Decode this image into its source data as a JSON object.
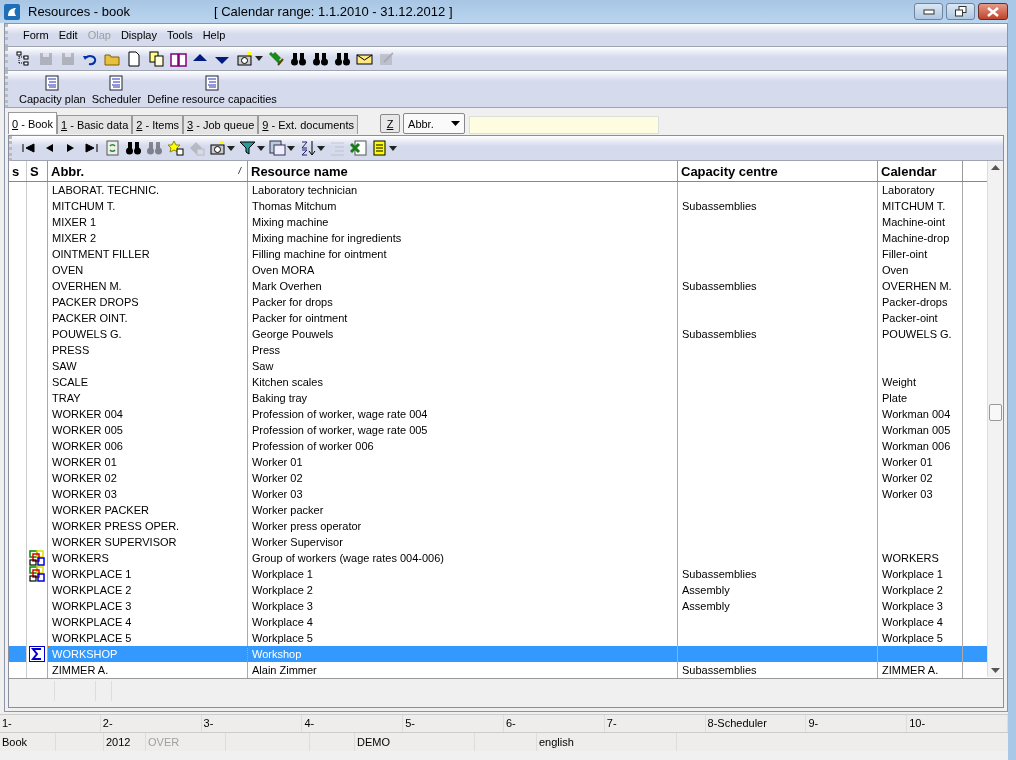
{
  "window": {
    "title": "Resources - book",
    "subtitle": "[ Calendar range: 1.1.2010 - 31.12.2012 ]"
  },
  "menu": [
    {
      "label": "Form",
      "disabled": false
    },
    {
      "label": "Edit",
      "disabled": false
    },
    {
      "label": "Olap",
      "disabled": true
    },
    {
      "label": "Display",
      "disabled": false
    },
    {
      "label": "Tools",
      "disabled": false
    },
    {
      "label": "Help",
      "disabled": false
    }
  ],
  "toolbar": [
    {
      "kind": "tree",
      "disabled": false
    },
    {
      "kind": "save",
      "disabled": true
    },
    {
      "kind": "saveas",
      "disabled": true
    },
    {
      "kind": "undo",
      "disabled": false
    },
    {
      "kind": "folder",
      "disabled": false
    },
    {
      "kind": "page",
      "disabled": false
    },
    {
      "kind": "copy",
      "disabled": false
    },
    {
      "kind": "book",
      "disabled": false
    },
    {
      "kind": "up",
      "disabled": false
    },
    {
      "kind": "down",
      "disabled": false
    },
    {
      "kind": "camera",
      "disabled": false
    },
    {
      "kind": "caret",
      "disabled": false
    },
    {
      "kind": "export",
      "disabled": false
    },
    {
      "kind": "binoculars",
      "disabled": false
    },
    {
      "kind": "binoculars",
      "disabled": false
    },
    {
      "kind": "binoculars",
      "disabled": false
    },
    {
      "kind": "mail",
      "disabled": false
    },
    {
      "kind": "edit",
      "disabled": true
    }
  ],
  "actions": [
    "Capacity plan",
    "Scheduler",
    "Define resource capacities"
  ],
  "tabs": [
    {
      "key": "0",
      "label": " - Book",
      "selected": true
    },
    {
      "key": "1",
      "label": " - Basic data",
      "selected": false
    },
    {
      "key": "2",
      "label": " - Items",
      "selected": false
    },
    {
      "key": "3",
      "label": " - Job queue",
      "selected": false
    },
    {
      "key": "9",
      "label": " - Ext. documents",
      "selected": false
    }
  ],
  "search": {
    "key_button": "Z",
    "field": "Abbr."
  },
  "nav_toolbar": [
    {
      "kind": "first",
      "disabled": false
    },
    {
      "kind": "prev",
      "disabled": false
    },
    {
      "kind": "next",
      "disabled": false
    },
    {
      "kind": "last",
      "disabled": false
    },
    {
      "kind": "refresh",
      "disabled": false
    },
    {
      "kind": "binoculars",
      "disabled": false
    },
    {
      "kind": "binoculars",
      "disabled": true
    },
    {
      "kind": "newstar",
      "disabled": false
    },
    {
      "kind": "remove",
      "disabled": true
    },
    {
      "kind": "camera",
      "disabled": false
    },
    {
      "kind": "caret",
      "disabled": false
    },
    {
      "kind": "filter",
      "disabled": false
    },
    {
      "kind": "caret",
      "disabled": false
    },
    {
      "kind": "columns",
      "disabled": false
    },
    {
      "kind": "caret",
      "disabled": false
    },
    {
      "kind": "sort",
      "disabled": false
    },
    {
      "kind": "caret",
      "disabled": false
    },
    {
      "kind": "indent",
      "disabled": true
    },
    {
      "kind": "excel",
      "disabled": false
    },
    {
      "kind": "note",
      "disabled": false
    },
    {
      "kind": "caret",
      "disabled": false
    }
  ],
  "table": {
    "columns": [
      {
        "label": "s"
      },
      {
        "label": "S"
      },
      {
        "label": "Abbr.",
        "sort": "/"
      },
      {
        "label": "Resource name"
      },
      {
        "label": "Capacity centre"
      },
      {
        "label": "Calendar"
      }
    ],
    "rows": [
      {
        "kind": "plain",
        "abbr": "LABORAT. TECHNIC.",
        "name": "Laboratory technician",
        "centre": "",
        "calendar": "Laboratory",
        "selected": false
      },
      {
        "kind": "plain",
        "abbr": "MITCHUM T.",
        "name": "Thomas Mitchum",
        "centre": "Subassemblies",
        "calendar": "MITCHUM T.",
        "selected": false
      },
      {
        "kind": "plain",
        "abbr": "MIXER 1",
        "name": "Mixing machine",
        "centre": "",
        "calendar": "Machine-oint",
        "selected": false
      },
      {
        "kind": "plain",
        "abbr": "MIXER 2",
        "name": "Mixing machine for ingredients",
        "centre": "",
        "calendar": "Machine-drop",
        "selected": false
      },
      {
        "kind": "plain",
        "abbr": "OINTMENT FILLER",
        "name": "Filling machine for ointment",
        "centre": "",
        "calendar": "Filler-oint",
        "selected": false
      },
      {
        "kind": "plain",
        "abbr": "OVEN",
        "name": "Oven MORA",
        "centre": "",
        "calendar": "Oven",
        "selected": false
      },
      {
        "kind": "plain",
        "abbr": "OVERHEN M.",
        "name": "Mark Overhen",
        "centre": "Subassemblies",
        "calendar": "OVERHEN M.",
        "selected": false
      },
      {
        "kind": "plain",
        "abbr": "PACKER DROPS",
        "name": "Packer for drops",
        "centre": "",
        "calendar": "Packer-drops",
        "selected": false
      },
      {
        "kind": "plain",
        "abbr": "PACKER OINT.",
        "name": "Packer for ointment",
        "centre": "",
        "calendar": "Packer-oint",
        "selected": false
      },
      {
        "kind": "plain",
        "abbr": "POUWELS G.",
        "name": "George Pouwels",
        "centre": "Subassemblies",
        "calendar": "POUWELS G.",
        "selected": false
      },
      {
        "kind": "plain",
        "abbr": "PRESS",
        "name": "Press",
        "centre": "",
        "calendar": "",
        "selected": false
      },
      {
        "kind": "plain",
        "abbr": "SAW",
        "name": "Saw",
        "centre": "",
        "calendar": "",
        "selected": false
      },
      {
        "kind": "plain",
        "abbr": "SCALE",
        "name": "Kitchen scales",
        "centre": "",
        "calendar": "Weight",
        "selected": false
      },
      {
        "kind": "plain",
        "abbr": "TRAY",
        "name": "Baking tray",
        "centre": "",
        "calendar": "Plate",
        "selected": false
      },
      {
        "kind": "plain",
        "abbr": "WORKER 004",
        "name": "Profession of worker, wage rate 004",
        "centre": "",
        "calendar": "Workman 004",
        "selected": false
      },
      {
        "kind": "plain",
        "abbr": "WORKER 005",
        "name": "Profession of worker, wage rate 005",
        "centre": "",
        "calendar": "Workman 005",
        "selected": false
      },
      {
        "kind": "plain",
        "abbr": "WORKER 006",
        "name": "Profession of worker 006",
        "centre": "",
        "calendar": "Workman 006",
        "selected": false
      },
      {
        "kind": "plain",
        "abbr": "WORKER 01",
        "name": "Worker 01",
        "centre": "",
        "calendar": "Worker 01",
        "selected": false
      },
      {
        "kind": "plain",
        "abbr": "WORKER 02",
        "name": "Worker 02",
        "centre": "",
        "calendar": "Worker 02",
        "selected": false
      },
      {
        "kind": "plain",
        "abbr": "WORKER 03",
        "name": "Worker 03",
        "centre": "",
        "calendar": "Worker 03",
        "selected": false
      },
      {
        "kind": "plain",
        "abbr": "WORKER PACKER",
        "name": "Worker packer",
        "centre": "",
        "calendar": "",
        "selected": false
      },
      {
        "kind": "plain",
        "abbr": "WORKER PRESS OPER.",
        "name": "Worker press operator",
        "centre": "",
        "calendar": "",
        "selected": false
      },
      {
        "kind": "plain",
        "abbr": "WORKER SUPERVISOR",
        "name": "Worker Supervisor",
        "centre": "",
        "calendar": "",
        "selected": false
      },
      {
        "kind": "group",
        "abbr": "WORKERS",
        "name": "Group of workers (wage rates 004-006)",
        "centre": "",
        "calendar": "WORKERS",
        "selected": false
      },
      {
        "kind": "group",
        "abbr": "WORKPLACE 1",
        "name": "Workplace 1",
        "centre": "Subassemblies",
        "calendar": "Workplace 1",
        "selected": false
      },
      {
        "kind": "plain",
        "abbr": "WORKPLACE 2",
        "name": "Workplace 2",
        "centre": "Assembly",
        "calendar": "Workplace 2",
        "selected": false
      },
      {
        "kind": "plain",
        "abbr": "WORKPLACE 3",
        "name": "Workplace 3",
        "centre": "Assembly",
        "calendar": "Workplace 3",
        "selected": false
      },
      {
        "kind": "plain",
        "abbr": "WORKPLACE 4",
        "name": "Workplace 4",
        "centre": "",
        "calendar": "Workplace 4",
        "selected": false
      },
      {
        "kind": "plain",
        "abbr": "WORKPLACE 5",
        "name": "Workplace 5",
        "centre": "",
        "calendar": "Workplace 5",
        "selected": false
      },
      {
        "kind": "sum",
        "abbr": "WORKSHOP",
        "name": "Workshop",
        "centre": "",
        "calendar": "",
        "selected": true
      },
      {
        "kind": "plain",
        "abbr": "ZIMMER A.",
        "name": "Alain Zimmer",
        "centre": "Subassemblies",
        "calendar": "ZIMMER A.",
        "selected": false
      }
    ]
  },
  "function_keys": [
    "1-",
    "2-",
    "3-",
    "4-",
    "5-",
    "6-",
    "7-",
    "8-Scheduler",
    "9-",
    "10-"
  ],
  "status_bar": [
    {
      "text": "Book",
      "disabled": false
    },
    {
      "text": "2012",
      "disabled": false
    },
    {
      "text": "OVER",
      "disabled": true
    },
    {
      "text": "DEMO",
      "disabled": false
    },
    {
      "text": "english",
      "disabled": false
    }
  ]
}
